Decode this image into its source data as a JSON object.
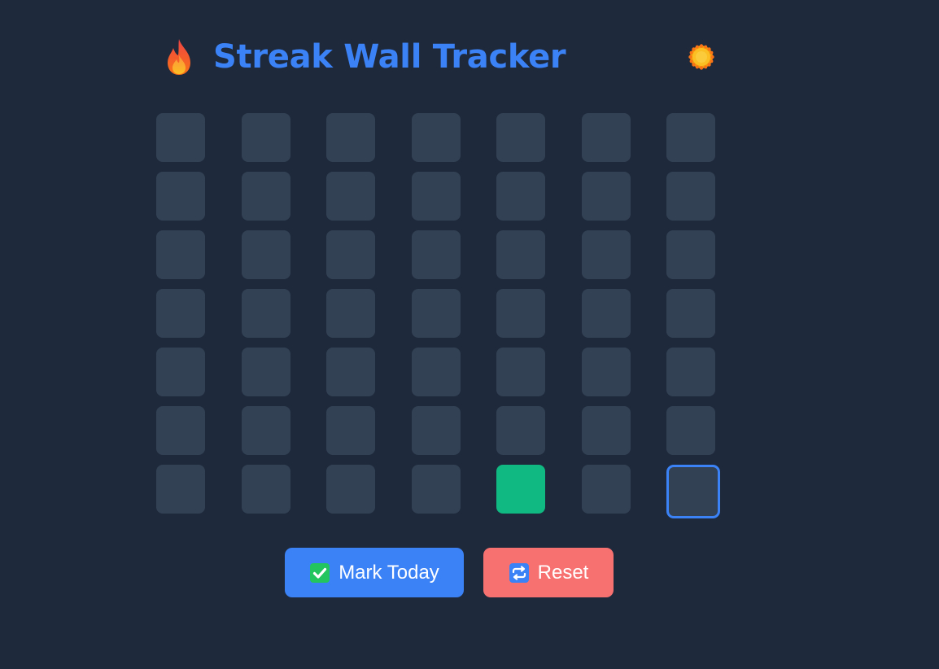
{
  "header": {
    "title": "Streak Wall Tracker",
    "title_icon": "fire-icon",
    "theme_toggle_icon": "sun-icon"
  },
  "grid": {
    "rows": 7,
    "columns": 7,
    "cells": [
      "empty",
      "empty",
      "empty",
      "empty",
      "empty",
      "empty",
      "empty",
      "empty",
      "empty",
      "empty",
      "empty",
      "empty",
      "empty",
      "empty",
      "empty",
      "empty",
      "empty",
      "empty",
      "empty",
      "empty",
      "empty",
      "empty",
      "empty",
      "empty",
      "empty",
      "empty",
      "empty",
      "empty",
      "empty",
      "empty",
      "empty",
      "empty",
      "empty",
      "empty",
      "empty",
      "empty",
      "empty",
      "empty",
      "empty",
      "empty",
      "empty",
      "empty",
      "empty",
      "empty",
      "empty",
      "empty",
      "done",
      "empty",
      "today"
    ]
  },
  "actions": {
    "mark_label": "Mark Today",
    "mark_icon": "check-mark-icon",
    "reset_label": "Reset",
    "reset_icon": "repeat-icon"
  },
  "colors": {
    "background": "#1e293b",
    "cell": "#334155",
    "done": "#10b981",
    "accent": "#3b82f6",
    "reset": "#f87171"
  }
}
